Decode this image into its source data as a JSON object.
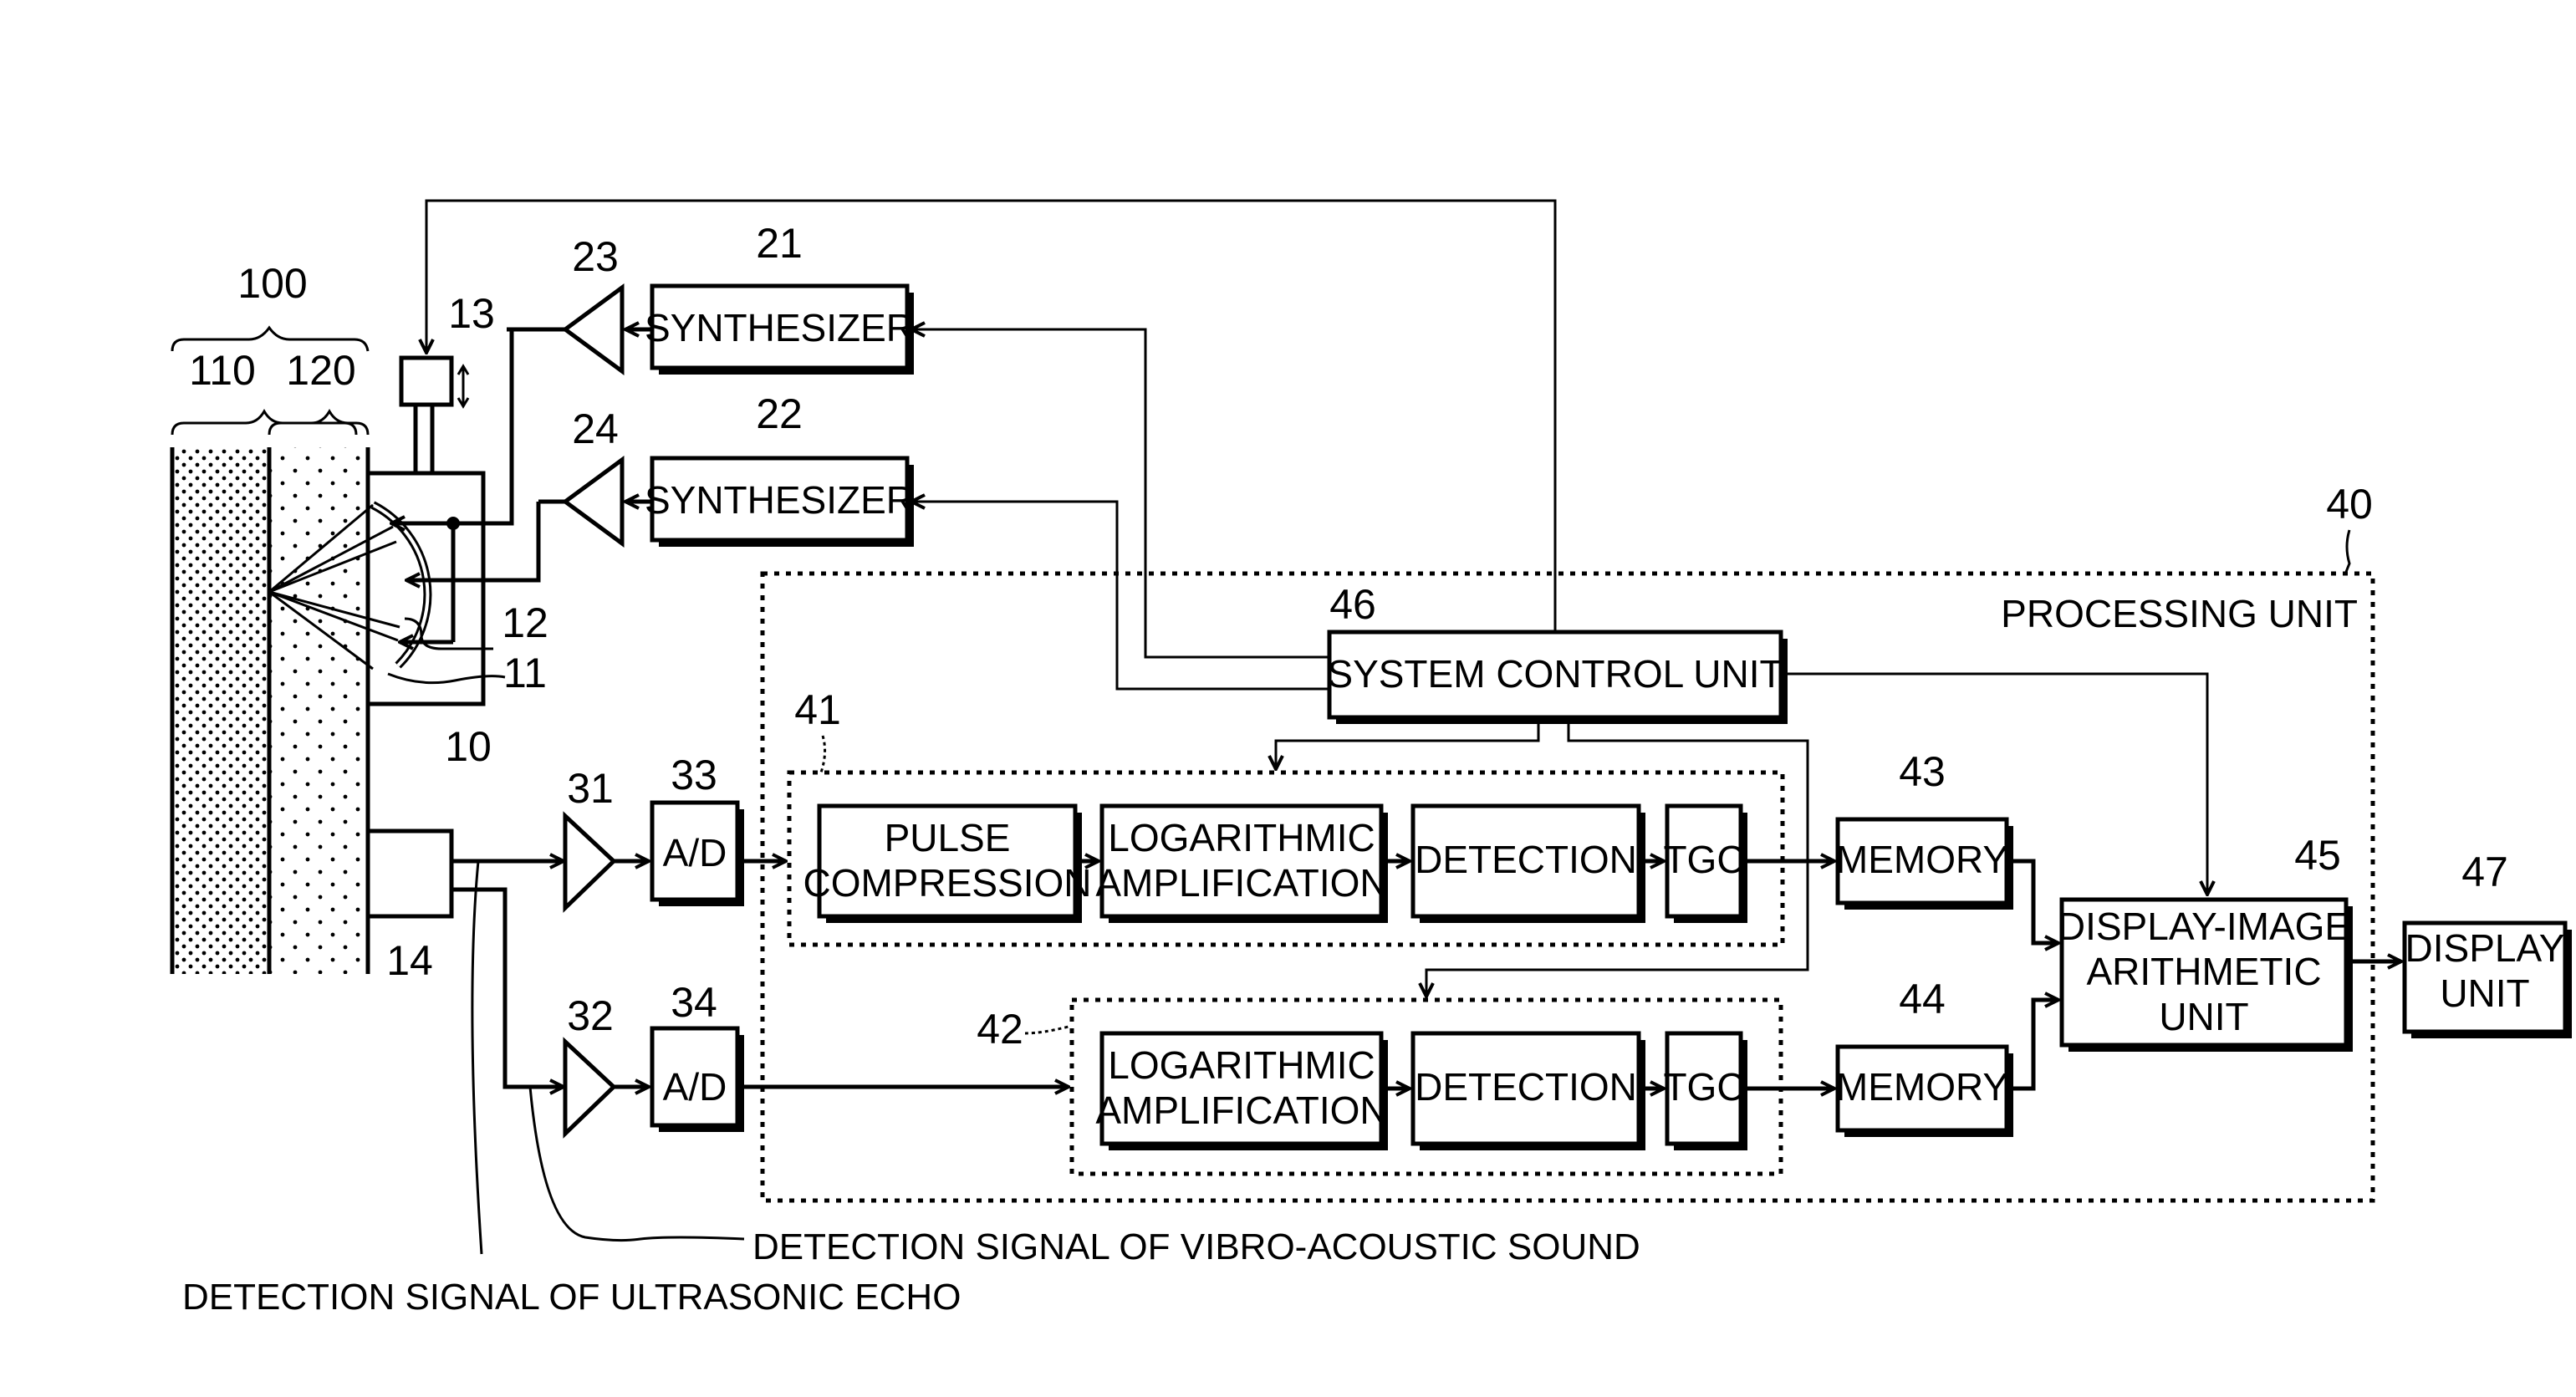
{
  "figure": {
    "labels": {
      "subject": "100",
      "layer_110": "110",
      "layer_120": "120",
      "probe": "10",
      "element_11": "11",
      "element_12": "12",
      "actuator_13": "13",
      "sensor_14": "14",
      "synth_21": "21",
      "synth_22": "22",
      "amp_23": "23",
      "amp_24": "24",
      "amp_31": "31",
      "amp_32": "32",
      "ad_33": "33",
      "ad_34": "34",
      "processing_40": "40",
      "group_41": "41",
      "group_42": "42",
      "memory_43": "43",
      "memory_44": "44",
      "display_image_45": "45",
      "system_control_46": "46",
      "display_47": "47"
    },
    "blocks": {
      "synthesizer_1": "SYNTHESIZER",
      "synthesizer_2": "SYNTHESIZER",
      "ad_1": "A/D",
      "ad_2": "A/D",
      "system_control": "SYSTEM CONTROL UNIT",
      "processing_unit": "PROCESSING UNIT",
      "pulse_compression": [
        "PULSE",
        "COMPRESSION"
      ],
      "log_amp_1": [
        "LOGARITHMIC",
        "AMPLIFICATION"
      ],
      "detection_1": "DETECTION",
      "tgc_1": "TGC",
      "log_amp_2": [
        "LOGARITHMIC",
        "AMPLIFICATION"
      ],
      "detection_2": "DETECTION",
      "tgc_2": "TGC",
      "memory_1": "MEMORY",
      "memory_2": "MEMORY",
      "display_image": [
        "DISPLAY-IMAGE",
        "ARITHMETIC",
        "UNIT"
      ],
      "display_unit": [
        "DISPLAY",
        "UNIT"
      ]
    },
    "captions": {
      "vibro_acoustic": "DETECTION SIGNAL OF VIBRO-ACOUSTIC SOUND",
      "ultrasonic_echo": "DETECTION SIGNAL OF ULTRASONIC ECHO"
    }
  }
}
